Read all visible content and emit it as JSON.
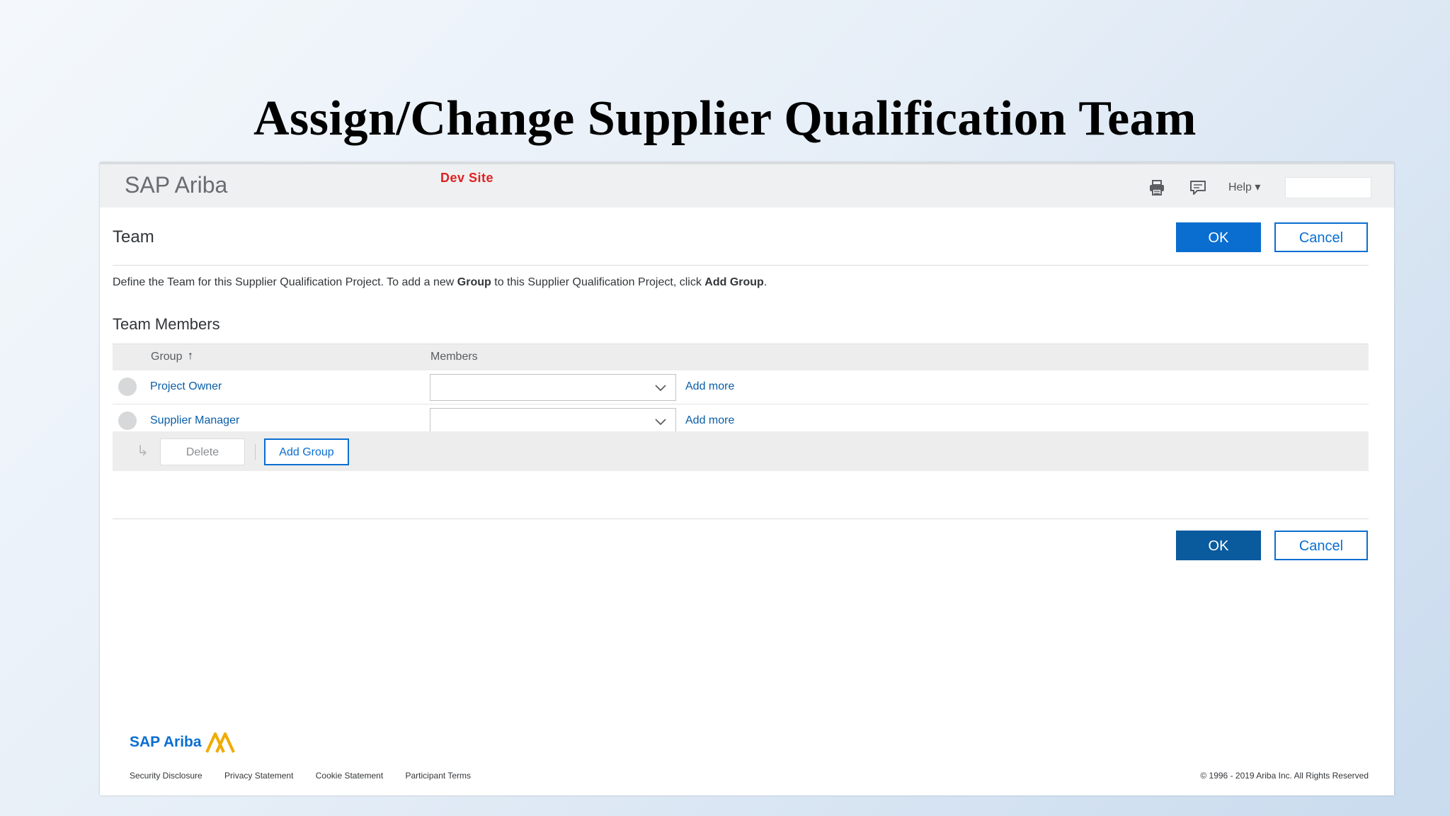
{
  "slide": {
    "title": "Assign/Change Supplier Qualification Team"
  },
  "topbar": {
    "brand": "SAP Ariba",
    "env_label": "Dev Site",
    "help_label": "Help ▾",
    "icons": [
      "printer-icon",
      "feedback-icon"
    ]
  },
  "page": {
    "title": "Team",
    "ok_label": "OK",
    "cancel_label": "Cancel",
    "description": {
      "part1": "Define the Team for this Supplier Qualification Project. To add a new ",
      "bold1": "Group",
      "part2": " to this Supplier Qualification Project, click ",
      "bold2": "Add Group",
      "part3": "."
    },
    "section_title": "Team Members"
  },
  "table": {
    "headers": {
      "group": "Group",
      "sort": "↑",
      "members": "Members"
    },
    "rows": [
      {
        "group": "Project Owner",
        "members": "",
        "add_more": "Add more"
      },
      {
        "group": "Supplier Manager",
        "members": "",
        "add_more": "Add more"
      }
    ],
    "footer": {
      "delete_label": "Delete",
      "add_group_label": "Add Group"
    }
  },
  "footer": {
    "logo_text": "SAP Ariba",
    "links": [
      "Security Disclosure",
      "Privacy Statement",
      "Cookie Statement",
      "Participant Terms"
    ],
    "copyright": "© 1996 - 2019 Ariba Inc. All Rights Reserved"
  },
  "colors": {
    "primary": "#0a6ed1",
    "link": "#0a5ea8",
    "env_label": "#e02020",
    "logo_accent": "#f0ab00"
  }
}
